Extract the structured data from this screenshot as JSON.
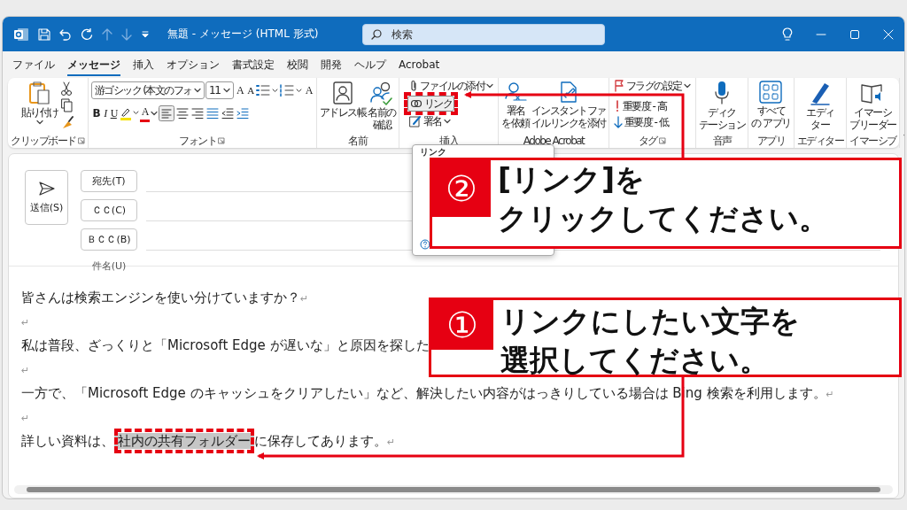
{
  "title_bar": {
    "title": "無題 - メッセージ (HTML 形式)",
    "search": {
      "placeholder": "検索"
    }
  },
  "menu_tabs": [
    {
      "label": "ファイル",
      "selected": false
    },
    {
      "label": "メッセージ",
      "selected": true
    },
    {
      "label": "挿入",
      "selected": false
    },
    {
      "label": "オプション",
      "selected": false
    },
    {
      "label": "書式設定",
      "selected": false
    },
    {
      "label": "校閲",
      "selected": false
    },
    {
      "label": "開発",
      "selected": false
    },
    {
      "label": "ヘルプ",
      "selected": false
    },
    {
      "label": "Acrobat",
      "selected": false
    }
  ],
  "ribbon": {
    "groups": [
      {
        "kind": "clipboard",
        "label": "クリップボード",
        "paste": "貼り付け"
      },
      {
        "kind": "font",
        "label": "フォント",
        "font_name": "游ゴシック (本文のフォ",
        "font_size": "11",
        "grow": "A",
        "shrink": "A",
        "clear_format": "A",
        "style_buttons": [
          "B",
          "I",
          "U"
        ],
        "font_color": "A"
      },
      {
        "kind": "names",
        "label": "名前",
        "buttons": [
          {
            "lines": [
              "アドレス帳"
            ]
          },
          {
            "lines": [
              "名前の",
              "確認"
            ]
          }
        ]
      },
      {
        "kind": "insert",
        "label": "挿入",
        "attach": "ファイルの添付",
        "link": "リンク",
        "signature": "署名"
      },
      {
        "kind": "acrobat",
        "label": "Adobe Acrobat",
        "buttons": [
          {
            "lines": [
              "署名",
              "を依頼"
            ]
          },
          {
            "lines": [
              "インスタントファ",
              "イルリンクを添付"
            ]
          }
        ]
      },
      {
        "kind": "tags",
        "label": "タグ",
        "flag": "フラグの設定",
        "high": "重要度 - 高",
        "low": "重要度 - 低"
      },
      {
        "kind": "voice",
        "label": "音声",
        "lines": [
          "ディク",
          "テーション"
        ]
      },
      {
        "kind": "apps",
        "label": "アプリ",
        "lines": [
          "すべて",
          "の アプリ"
        ]
      },
      {
        "kind": "editor",
        "label": "エディター",
        "lines": [
          "エディ",
          "ター"
        ]
      },
      {
        "kind": "immersive",
        "label": "イマーシブ",
        "lines": [
          "イマーシ",
          "ブリーダー"
        ]
      }
    ]
  },
  "compose": {
    "send": "送信(S)",
    "recipients": [
      {
        "label": "宛先(T)"
      },
      {
        "label": "ＣＣ(C)"
      },
      {
        "label": "ＢＣＣ(B)"
      }
    ],
    "subject_label": "件名(U)"
  },
  "link_popup": {
    "title": "リンク"
  },
  "body": {
    "mark": "↵",
    "paragraphs": [
      {
        "kind": "text",
        "text": "皆さんは検索エンジンを使い分けていますか？"
      },
      {
        "kind": "empty"
      },
      {
        "kind": "cut",
        "text": "私は普段、ざっくりと「Microsoft Edge が遅いな」と原因を探した"
      },
      {
        "kind": "empty"
      },
      {
        "kind": "text",
        "text": "一方で、「Microsoft Edge のキャッシュをクリアしたい」など、解決したい内容がはっきりしている場合は Bing 検索を利用します。"
      },
      {
        "kind": "empty"
      },
      {
        "kind": "selection",
        "before": "詳しい資料は、",
        "selection": "社内の共有フォルダー",
        "after": "に保存してあります。"
      }
    ]
  },
  "annotations": [
    {
      "number": "②",
      "lines": [
        "[リンク]を",
        "クリックしてください。"
      ]
    },
    {
      "number": "①",
      "lines": [
        "リンクにしたい文字を",
        "選択してください。"
      ]
    }
  ]
}
